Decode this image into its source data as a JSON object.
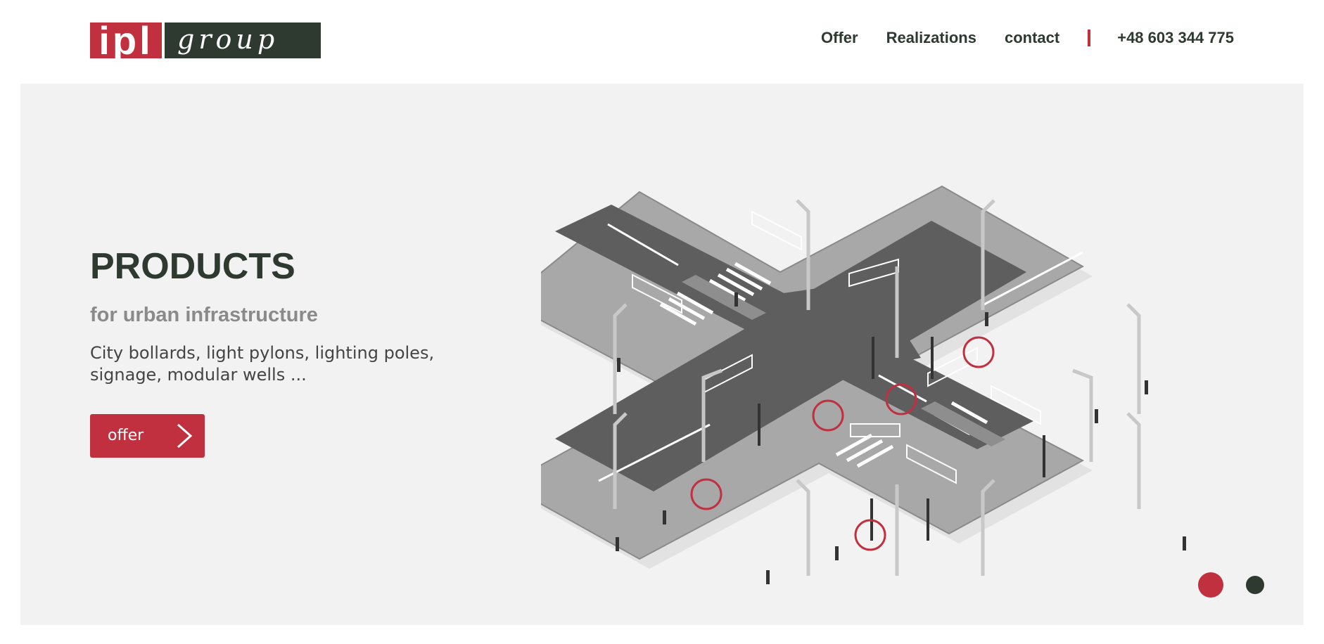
{
  "header": {
    "logo_ipl": "ipl",
    "logo_group": "group",
    "nav": [
      {
        "label": "Offer"
      },
      {
        "label": "Realizations"
      },
      {
        "label": "contact"
      }
    ],
    "phone": "+48 603 344 775"
  },
  "hero": {
    "title": "PRODUCTS",
    "subtitle": "for urban infrastructure",
    "description": "City bollards, light pylons, lighting poles, signage, modular wells ...",
    "button_label": "offer",
    "slides": 2,
    "active_slide": 1
  },
  "colors": {
    "brand_red": "#c0303f",
    "brand_dark_green": "#2e3a30",
    "hero_bg": "#f2f2f2"
  }
}
